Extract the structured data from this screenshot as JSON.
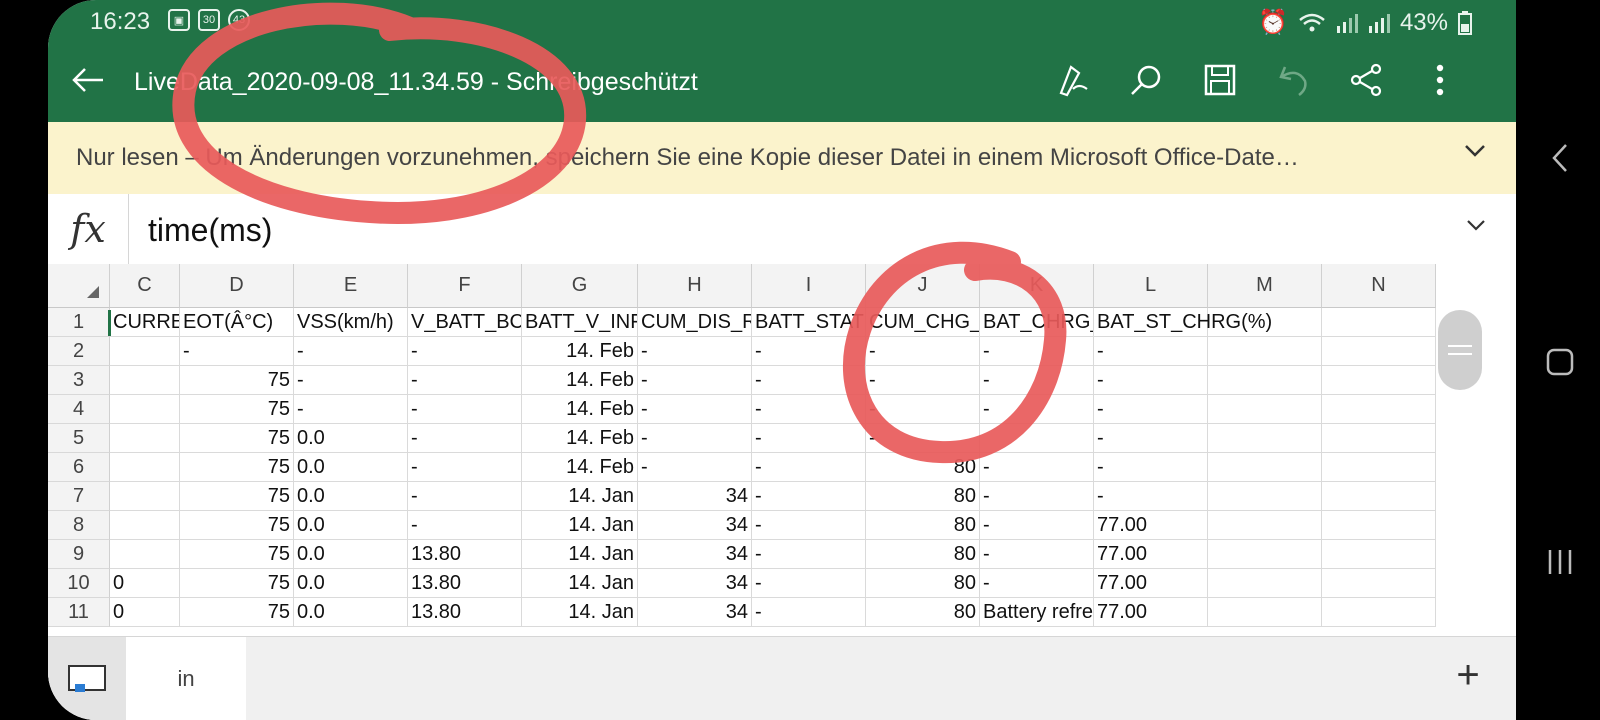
{
  "status_bar": {
    "time": "16:23",
    "calendar_day": "30",
    "notification_count": "43",
    "battery": "43%"
  },
  "toolbar": {
    "title": "LiveData_2020-09-08_11.34.59 - Schreibgeschützt",
    "icons": [
      "back-arrow-icon",
      "pen-icon",
      "search-icon",
      "save-icon",
      "undo-icon",
      "share-icon",
      "more-icon"
    ]
  },
  "banner": {
    "text": "Nur lesen – Um Änderungen vorzunehmen, speichern Sie eine Kopie dieser Datei in einem Microsoft Office-Date…"
  },
  "formula_bar": {
    "fx_label": "fx",
    "value": "time(ms)"
  },
  "grid": {
    "columns": [
      "C",
      "D",
      "E",
      "F",
      "G",
      "H",
      "I",
      "J",
      "K",
      "L",
      "M",
      "N"
    ],
    "rows": [
      {
        "num": "1",
        "cells": [
          "CURREN",
          "EOT(Â°C)",
          "VSS(km/h)",
          "V_BATT_BCM",
          "BATT_V_INFO",
          "CUM_DIS_RU",
          "BATT_STAT",
          "CUM_CHG_C",
          "BAT_CHRG_M",
          "BAT_ST_CHRG(%)",
          "",
          ""
        ]
      },
      {
        "num": "2",
        "cells": [
          "",
          "-",
          "-",
          "-",
          "14. Feb",
          "-",
          "-",
          "-",
          "-",
          "-",
          "",
          ""
        ]
      },
      {
        "num": "3",
        "cells": [
          "",
          "75",
          "-",
          "-",
          "14. Feb",
          "-",
          "-",
          "-",
          "-",
          "-",
          "",
          ""
        ]
      },
      {
        "num": "4",
        "cells": [
          "",
          "75",
          "-",
          "-",
          "14. Feb",
          "-",
          "-",
          "-",
          "-",
          "-",
          "",
          ""
        ]
      },
      {
        "num": "5",
        "cells": [
          "",
          "75",
          "0.0",
          "-",
          "14. Feb",
          "-",
          "-",
          "-",
          "",
          "-",
          "",
          ""
        ]
      },
      {
        "num": "6",
        "cells": [
          "",
          "75",
          "0.0",
          "-",
          "14. Feb",
          "-",
          "-",
          "80",
          "-",
          "-",
          "",
          ""
        ]
      },
      {
        "num": "7",
        "cells": [
          "",
          "75",
          "0.0",
          "-",
          "14. Jan",
          "34",
          "-",
          "80",
          "-",
          "-",
          "",
          ""
        ]
      },
      {
        "num": "8",
        "cells": [
          "",
          "75",
          "0.0",
          "-",
          "14. Jan",
          "34",
          "-",
          "80",
          "-",
          "77.00",
          "",
          ""
        ]
      },
      {
        "num": "9",
        "cells": [
          "",
          "75",
          "0.0",
          "13.80",
          "14. Jan",
          "34",
          "-",
          "80",
          "-",
          "77.00",
          "",
          ""
        ]
      },
      {
        "num": "10",
        "cells": [
          "0",
          "75",
          "0.0",
          "13.80",
          "14. Jan",
          "34",
          "-",
          "80",
          "-",
          "77.00",
          "",
          ""
        ]
      },
      {
        "num": "11",
        "cells": [
          "0",
          "75",
          "0.0",
          "13.80",
          "14. Jan",
          "34",
          "-",
          "80",
          "Battery refre",
          "77.00",
          "",
          ""
        ]
      }
    ]
  },
  "bottom_bar": {
    "sheet_tab": "in",
    "add_label": "+"
  },
  "android_nav": [
    "chevron-left-icon",
    "home-square-icon",
    "recent-apps-icon"
  ],
  "colors": {
    "excel_green": "#217346",
    "banner_bg": "#fbf3cc",
    "annotation_red": "#e85a5a"
  }
}
